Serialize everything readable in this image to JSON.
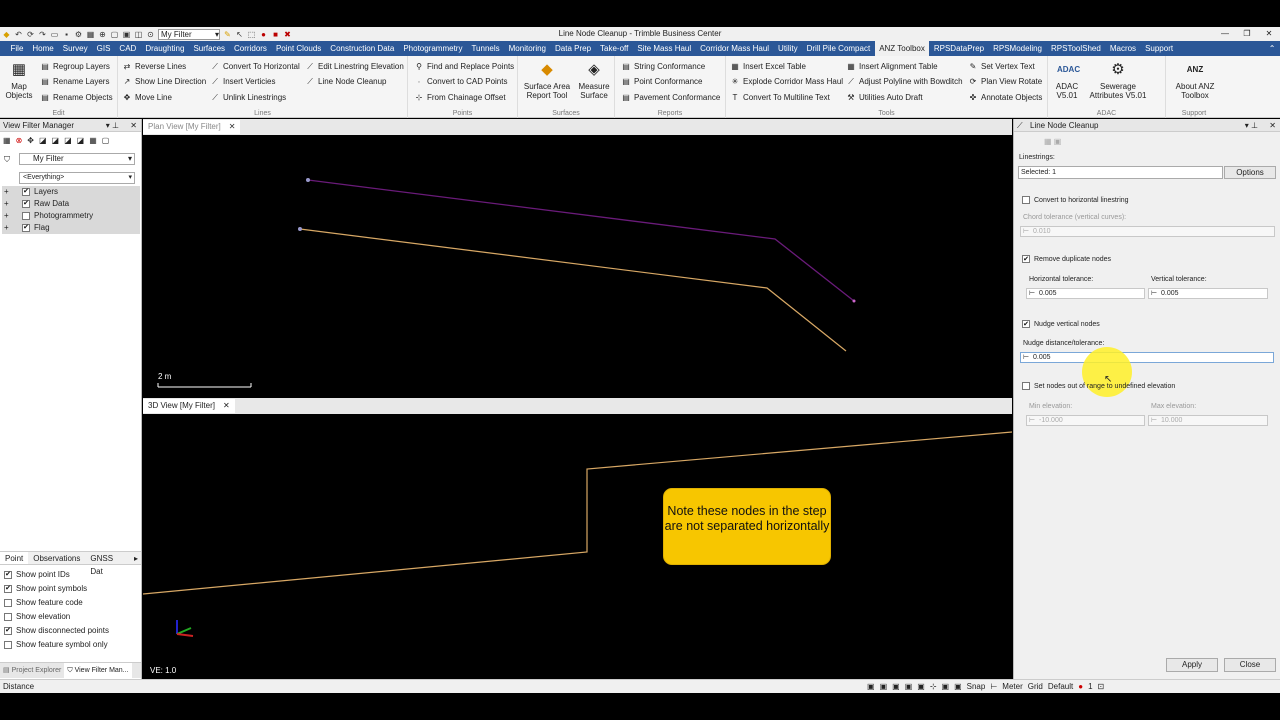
{
  "window": {
    "title": "Line Node Cleanup - Trimble Business Center",
    "filter": "My Filter"
  },
  "menu": [
    "File",
    "Home",
    "Survey",
    "GIS",
    "CAD",
    "Draughting",
    "Surfaces",
    "Corridors",
    "Point Clouds",
    "Construction Data",
    "Photogrammetry",
    "Tunnels",
    "Monitoring",
    "Data Prep",
    "Take-off",
    "Site Mass Haul",
    "Corridor Mass Haul",
    "Utility",
    "Drill Pile Compact",
    "ANZ Toolbox",
    "RPSDataPrep",
    "RPSModeling",
    "RPSToolShed",
    "Macros",
    "Support"
  ],
  "ribbon": {
    "edit": {
      "label": "Edit",
      "map": "Map Objects",
      "regroup": "Regroup Layers",
      "rename_layers": "Rename Layers",
      "rename_objects": "Rename Objects"
    },
    "lines": {
      "label": "Lines",
      "reverse": "Reverse Lines",
      "show_dir": "Show Line Direction",
      "move": "Move Line",
      "conv_horiz": "Convert To Horizontal",
      "insert_vert": "Insert Verticies",
      "unlink": "Unlink Linestrings",
      "edit_elev": "Edit Linestring Elevation",
      "node_cleanup": "Line Node Cleanup"
    },
    "points": {
      "label": "Points",
      "find": "Find and Replace Points",
      "cad": "Convert to CAD Points",
      "chainage": "From Chainage Offset"
    },
    "surfaces": {
      "label": "Surfaces",
      "area": "Surface Area Report Tool",
      "measure": "Measure Surface"
    },
    "reports": {
      "label": "Reports",
      "string": "String Conformance",
      "point": "Point Conformance",
      "pavement": "Pavement Conformance"
    },
    "tools": {
      "label": "Tools",
      "excel": "Insert Excel Table",
      "explode": "Explode Corridor Mass Haul",
      "multiline": "Convert To Multiline Text",
      "align": "Insert Alignment Table",
      "adjust": "Adjust Polyline with Bowditch",
      "auto": "Utilities Auto Draft",
      "vertex": "Set Vertex Text",
      "rotate": "Plan View Rotate",
      "annotate": "Annotate Objects"
    },
    "adac": {
      "label": "ADAC",
      "adac": "ADAC V5.01",
      "sew": "Sewerage Attributes V5.01"
    },
    "support": {
      "label": "Support",
      "about": "About ANZ Toolbox"
    }
  },
  "left": {
    "title": "View Filter Manager",
    "filter": "My Filter",
    "everything": "<Everything>",
    "items": [
      "Layers",
      "Raw Data",
      "Photogrammetry",
      "Flag"
    ],
    "tabs": [
      "Point",
      "Observations",
      "GNSS Dat"
    ],
    "opts": [
      "Show point IDs",
      "Show point symbols",
      "Show feature code",
      "Show elevation",
      "Show disconnected points",
      "Show feature symbol only"
    ],
    "bottom_tabs": [
      "Project Explorer",
      "View Filter Man..."
    ]
  },
  "plan": {
    "tab": "Plan View [My Filter]",
    "scale": "2 m"
  },
  "view3d": {
    "tab": "3D View [My Filter]",
    "ve": "VE: 1.0"
  },
  "callout": {
    "text": "Note these nodes in the step are not separated horizontally"
  },
  "panel": {
    "title": "Line Node Cleanup",
    "linestrings": "Linestrings:",
    "selected": "Selected: 1",
    "options": "Options",
    "convert": "Convert to horizontal linestring",
    "chord": "Chord tolerance (vertical curves):",
    "chord_val": "0.010",
    "remove": "Remove duplicate nodes",
    "htol": "Horizontal tolerance:",
    "htol_val": "0.005",
    "vtol": "Vertical tolerance:",
    "vtol_val": "0.005",
    "nudge": "Nudge vertical nodes",
    "nudge_lbl": "Nudge distance/tolerance:",
    "nudge_val": "0.005",
    "setnodes": "Set nodes out of range to undefined elevation",
    "min": "Min elevation:",
    "min_val": "-10.000",
    "max": "Max elevation:",
    "max_val": "10.000",
    "apply": "Apply",
    "close": "Close"
  },
  "status": {
    "left": "Distance",
    "snap": "Snap",
    "meter": "Meter",
    "grid": "Grid",
    "default": "Default",
    "count": "1"
  }
}
